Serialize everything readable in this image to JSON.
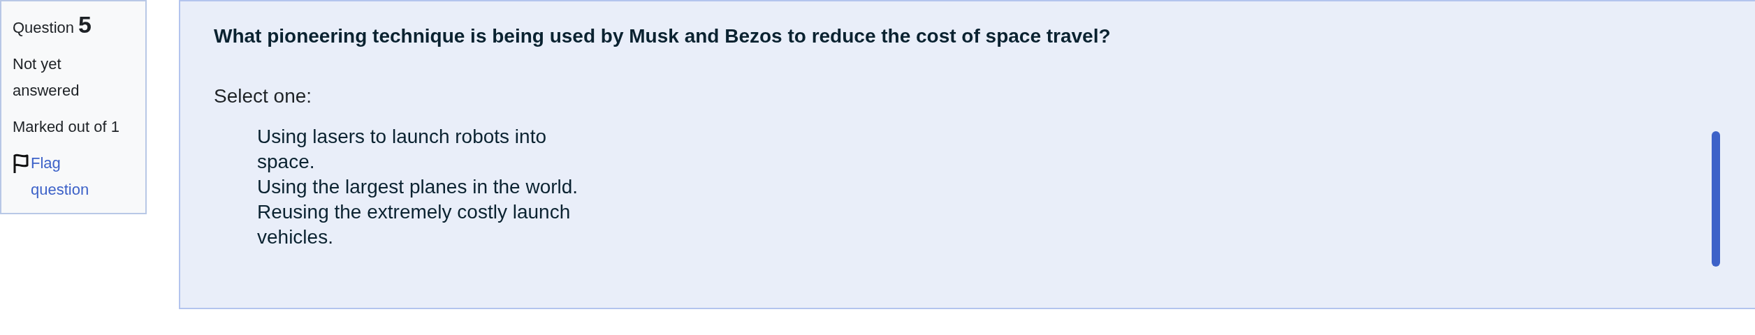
{
  "info": {
    "label": "Question",
    "number": "5",
    "status": "Not yet answered",
    "marks": "Marked out of 1",
    "flag_link": "Flag question"
  },
  "question": {
    "text": "What pioneering technique is being used by Musk and Bezos to reduce the cost of space travel?",
    "prompt": "Select one:",
    "options": [
      {
        "label": "Using lasers to launch robots into space.",
        "selected": false
      },
      {
        "label": "Using the largest planes in the world.",
        "selected": false
      },
      {
        "label": "Reusing the extremely costly launch vehicles.",
        "selected": false
      }
    ]
  }
}
